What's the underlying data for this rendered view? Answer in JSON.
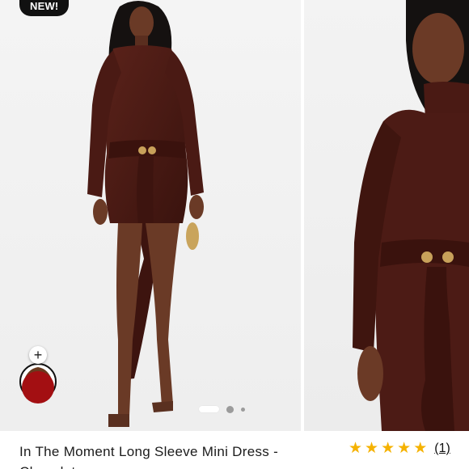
{
  "badge": {
    "label": "NEW!"
  },
  "product": {
    "title": "In The Moment Long Sleeve Mini Dress - Chocolate",
    "rating_value": 5,
    "review_count_label": "(1)"
  },
  "gallery": {
    "active_index": 1,
    "total_indicators": 3
  },
  "swatch": {
    "add_label": "+",
    "selected_color": "#a30f12"
  },
  "colors": {
    "dress": "#4a1a14",
    "skin": "#6a3a26",
    "star": "#f5b200"
  }
}
